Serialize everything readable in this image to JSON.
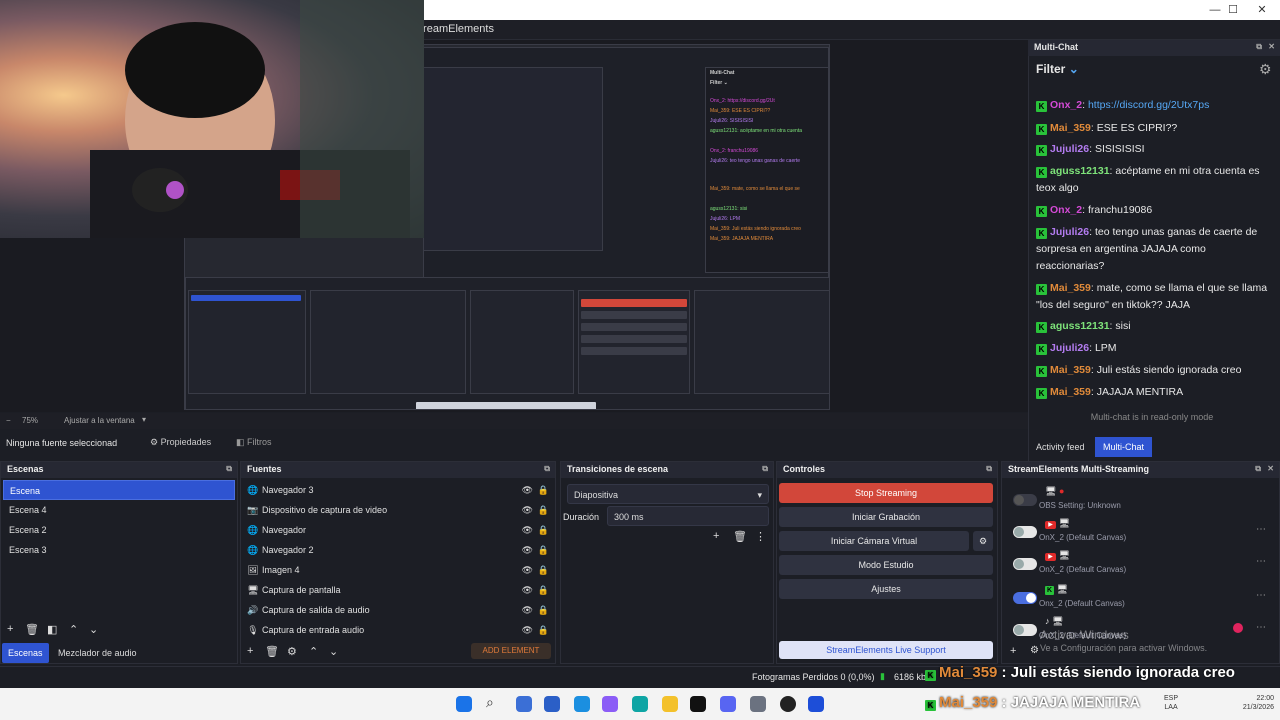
{
  "menu": {
    "streamelements": "treamElements"
  },
  "window_controls": [
    "—",
    "☐",
    "✕"
  ],
  "preview": {
    "zoom": "75%",
    "fit": "Ajustar a la ventana",
    "mini_chat": [
      "Onx_2: https://discord.gg/2Ut",
      "Mai_359: ESE ES CIPRI??",
      "Jujuli26: SISISISISI",
      "aguss12131: acéptame en mi otra cuenta",
      "Onx_2: franchu19086",
      "Jujuli26: teo tengo unas ganas de caerte",
      "Mai_359: mate, como se llama el que se",
      "aguss12131: sisi",
      "Jujuli26: LPM",
      "Mai_359: Juli estás siendo ignorada creo",
      "Mai_359: JAJAJA MENTIRA"
    ]
  },
  "source_toolbar": {
    "selected": "Ninguna fuente seleccionad",
    "properties": "Propiedades",
    "filters": "Filtros"
  },
  "scenes": {
    "title": "Escenas",
    "items": [
      "Escena",
      "Escena 4",
      "Escena 2",
      "Escena 3"
    ]
  },
  "sources": {
    "title": "Fuentes",
    "items": [
      {
        "label": "Navegador 3",
        "icon": "globe-icon"
      },
      {
        "label": "Dispositivo de captura de video",
        "icon": "camera-icon"
      },
      {
        "label": "Navegador",
        "icon": "globe-icon"
      },
      {
        "label": "Navegador 2",
        "icon": "globe-icon"
      },
      {
        "label": "Imagen 4",
        "icon": "image-icon"
      },
      {
        "label": "Captura de pantalla",
        "icon": "monitor-icon"
      },
      {
        "label": "Captura de salida de audio",
        "icon": "speaker-icon"
      },
      {
        "label": "Captura de entrada audio",
        "icon": "mic-icon"
      }
    ],
    "add_element": "ADD ELEMENT"
  },
  "transitions": {
    "title": "Transiciones de escena",
    "type": "Diapositiva",
    "duration_label": "Duración",
    "duration_value": "300 ms"
  },
  "controls": {
    "title": "Controles",
    "stop_streaming": "Stop Streaming",
    "start_recording": "Iniciar Grabación",
    "virtual_camera": "Iniciar Cámara Virtual",
    "studio_mode": "Modo Estudio",
    "settings": "Ajustes",
    "live_support": "StreamElements Live Support"
  },
  "multistreaming": {
    "title": "StreamElements Multi-Streaming",
    "rows": [
      {
        "label": "OBS Setting: Unknown",
        "on": false
      },
      {
        "label": "OnX_2 (Default Canvas)",
        "on": false
      },
      {
        "label": "OnX_2 (Default Canvas)",
        "on": false
      },
      {
        "label": "Onx_2 (Default Canvas)",
        "on": true
      },
      {
        "label": "OnX_2 (Default Canvas)",
        "on": false
      }
    ],
    "watermark_1": "Activar Windows",
    "watermark_2": "Ve a Configuración para activar Windows."
  },
  "bottom_tabs": {
    "scenes": "Escenas",
    "mixer": "Mezclador de audio"
  },
  "chat": {
    "title": "Multi-Chat",
    "filter": "Filter",
    "readonly": "Multi-chat is in read-only mode",
    "tab_activity": "Activity feed",
    "tab_multichat": "Multi-Chat",
    "messages": [
      {
        "user": "Onx_2",
        "color": "pink",
        "text": "https://discord.gg/2Utx7ps",
        "link": true
      },
      {
        "user": "Mai_359",
        "color": "orange",
        "text": "ESE ES CIPRI??"
      },
      {
        "user": "Jujuli26",
        "color": "violet",
        "text": "SISISISISI"
      },
      {
        "user": "aguss12131",
        "color": "green",
        "text": "acéptame en mi otra cuenta es teox algo"
      },
      {
        "user": "Onx_2",
        "color": "pink",
        "text": "franchu19086"
      },
      {
        "user": "Jujuli26",
        "color": "violet",
        "text": "teo tengo unas ganas de caerte de sorpresa en argentina JAJAJA como reaccionarias?"
      },
      {
        "user": "Mai_359",
        "color": "orange",
        "text": "mate, como se llama el que se llama \"los del seguro\" en tiktok?? JAJA"
      },
      {
        "user": "aguss12131",
        "color": "green",
        "text": "sisi"
      },
      {
        "user": "Jujuli26",
        "color": "violet",
        "text": "LPM"
      },
      {
        "user": "Mai_359",
        "color": "orange",
        "text": "Juli estás siendo ignorada creo"
      },
      {
        "user": "Mai_359",
        "color": "orange",
        "text": "JAJAJA MENTIRA"
      }
    ]
  },
  "status": {
    "frames_lost": "Fotogramas Perdidos 0 (0,0%)",
    "bitrate": "6186 kb",
    "overlay_1_user": "Mai_359",
    "overlay_1_text": " : Juli estás siendo ignorada creo",
    "overlay_2_user": "Mai_359",
    "overlay_2_text": " : JAJAJA MENTIRA"
  },
  "taskbar": {
    "lang": "ESP",
    "lang2": "LAA",
    "time": "22:00",
    "date": "21/3/2026"
  }
}
